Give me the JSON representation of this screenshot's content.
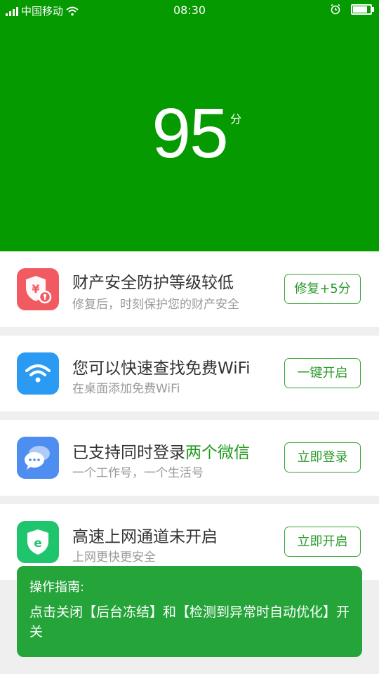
{
  "status_bar": {
    "carrier": "中国移动",
    "time": "08:30",
    "battery_level": 0.9
  },
  "hero": {
    "score": "95",
    "unit": "分",
    "background": "#049a00"
  },
  "cards": [
    {
      "icon": "shield-yen-icon",
      "title": "财产安全防护等级较低",
      "subtitle": "修复后，时刻保护您的财产安全",
      "button": "修复+5分"
    },
    {
      "icon": "wifi-icon",
      "title": "您可以快速查找免费WiFi",
      "subtitle": "在桌面添加免费WiFi",
      "button": "一键开启"
    },
    {
      "icon": "wechat-icon",
      "title_prefix": "已支持同时登录",
      "title_highlight": "两个微信",
      "subtitle": "一个工作号，一个生活号",
      "button": "立即登录"
    },
    {
      "icon": "shield-browser-icon",
      "title": "高速上网通道未开启",
      "subtitle": "上网更快更安全",
      "button": "立即开启"
    }
  ],
  "guide": {
    "title": "操作指南:",
    "body": "点击关闭【后台冻结】和【检测到异常时自动优化】开关"
  },
  "colors": {
    "accent": "#2a9a2a",
    "guide_bg": "#25a43a"
  }
}
